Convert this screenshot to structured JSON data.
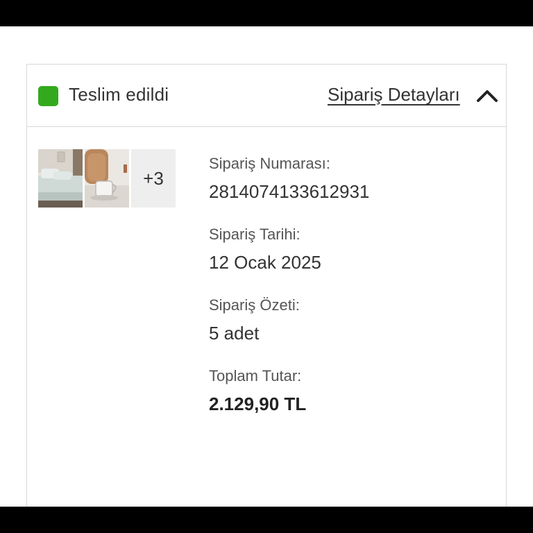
{
  "order": {
    "status": {
      "text": "Teslim edildi",
      "color": "#33aa1d"
    },
    "details_link": "Sipariş Detayları",
    "collapse_icon": "chevron-up-icon",
    "thumbnails": {
      "items": [
        {
          "icon": "bedroom-product-thumbnail"
        },
        {
          "icon": "mug-product-thumbnail"
        }
      ],
      "more_count": "+3"
    },
    "fields": {
      "number": {
        "label": "Sipariş Numarası:",
        "value": "2814074133612931"
      },
      "date": {
        "label": "Sipariş Tarihi:",
        "value": "12 Ocak 2025"
      },
      "summary": {
        "label": "Sipariş Özeti:",
        "value": "5 adet"
      },
      "total": {
        "label": "Toplam Tutar:",
        "value": "2.129,90 TL"
      }
    }
  }
}
